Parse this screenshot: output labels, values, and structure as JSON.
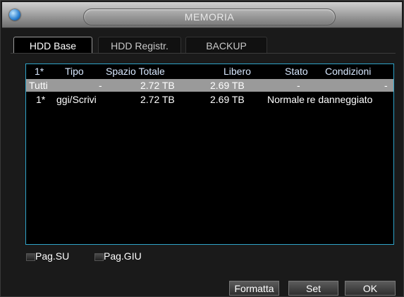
{
  "window": {
    "title": "MEMORIA"
  },
  "tabs": [
    {
      "label": "HDD Base",
      "active": true
    },
    {
      "label": "HDD Registr.",
      "active": false
    },
    {
      "label": "BACKUP",
      "active": false
    }
  ],
  "table": {
    "columns": [
      "1*",
      "Tipo",
      "Spazio Totale",
      "Libero",
      "Stato",
      "Condizioni"
    ],
    "rows": [
      {
        "index": "Tutti",
        "tipo": "-",
        "spazio_totale": "2.72 TB",
        "libero": "2.69 TB",
        "stato": "-",
        "condizioni": "-",
        "selected": true
      },
      {
        "index": "1*",
        "tipo": "ggi/Scrivi",
        "spazio_totale": "2.72 TB",
        "libero": "2.69 TB",
        "stato": "Normale",
        "condizioni": "re danneggiato",
        "selected": false
      }
    ]
  },
  "pager": {
    "up_label": "Pag.SU",
    "down_label": "Pag.GIU"
  },
  "buttons": {
    "format_label": "Formatta",
    "set_label": "Set",
    "ok_label": "OK"
  },
  "colors": {
    "grid_border": "#2fa3c8",
    "selected_row": "#9a9a9a",
    "background": "#1a1a1a"
  }
}
